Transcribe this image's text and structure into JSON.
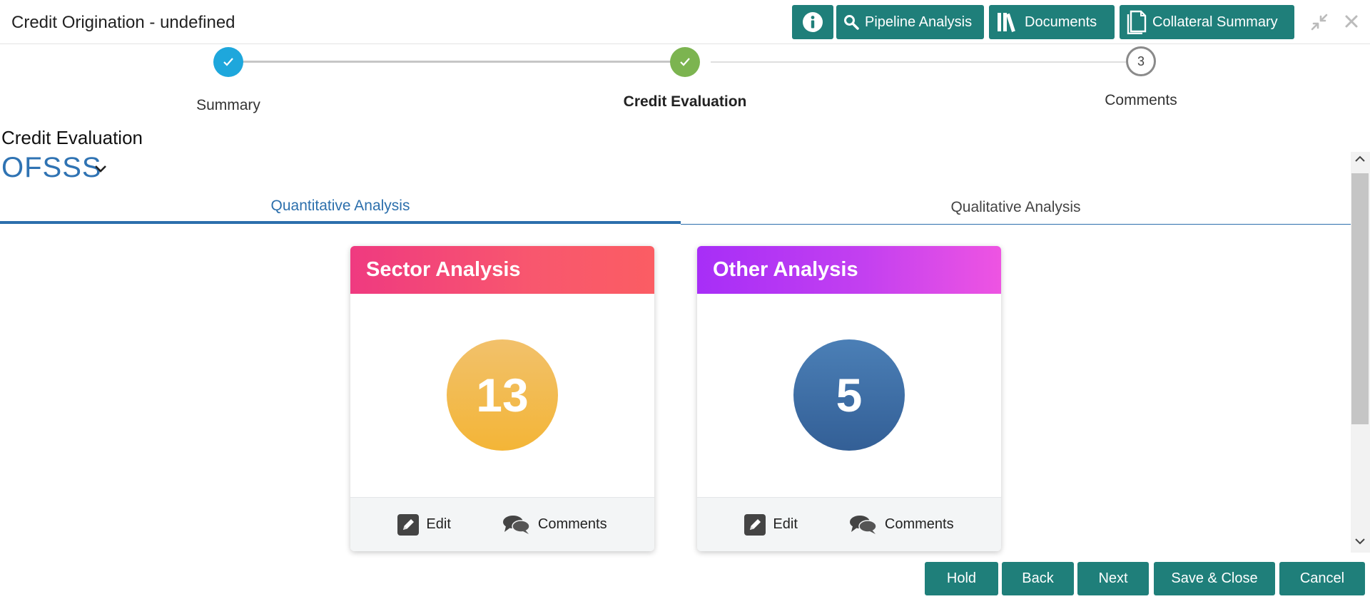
{
  "header": {
    "title": "Credit Origination - undefined",
    "buttons": {
      "pipeline": "Pipeline Analysis",
      "documents": "Documents",
      "collateral": "Collateral Summary"
    }
  },
  "stepper": {
    "steps": [
      {
        "label": "Summary",
        "status": "completed"
      },
      {
        "label": "Credit Evaluation",
        "status": "current"
      },
      {
        "label": "Comments",
        "number": "3",
        "status": "pending"
      }
    ]
  },
  "section": {
    "title": "Credit Evaluation",
    "entity": "OFSSS"
  },
  "tabs": [
    {
      "label": "Quantitative Analysis",
      "active": true
    },
    {
      "label": "Qualitative Analysis",
      "active": false
    }
  ],
  "cards": [
    {
      "title": "Sector Analysis",
      "count": "13",
      "edit_label": "Edit",
      "comments_label": "Comments"
    },
    {
      "title": "Other Analysis",
      "count": "5",
      "edit_label": "Edit",
      "comments_label": "Comments"
    }
  ],
  "footer": {
    "hold": "Hold",
    "back": "Back",
    "next": "Next",
    "save_close": "Save & Close",
    "cancel": "Cancel"
  },
  "colors": {
    "primary_button": "#1f7f7a",
    "step_completed_1": "#1ea7dc",
    "step_completed_2": "#7cb450",
    "tab_active": "#2c6fac",
    "sector_header": "#f8576e",
    "other_header": "#c340f0",
    "sector_circle": "#f3b537",
    "other_circle": "#3d6ba3"
  },
  "icons": [
    "info-icon",
    "search-icon",
    "books-icon",
    "document-icon",
    "minimize-icon",
    "close-icon",
    "check-icon",
    "chevron-down-icon",
    "pencil-icon",
    "chat-bubbles-icon",
    "chevron-up-icon"
  ]
}
